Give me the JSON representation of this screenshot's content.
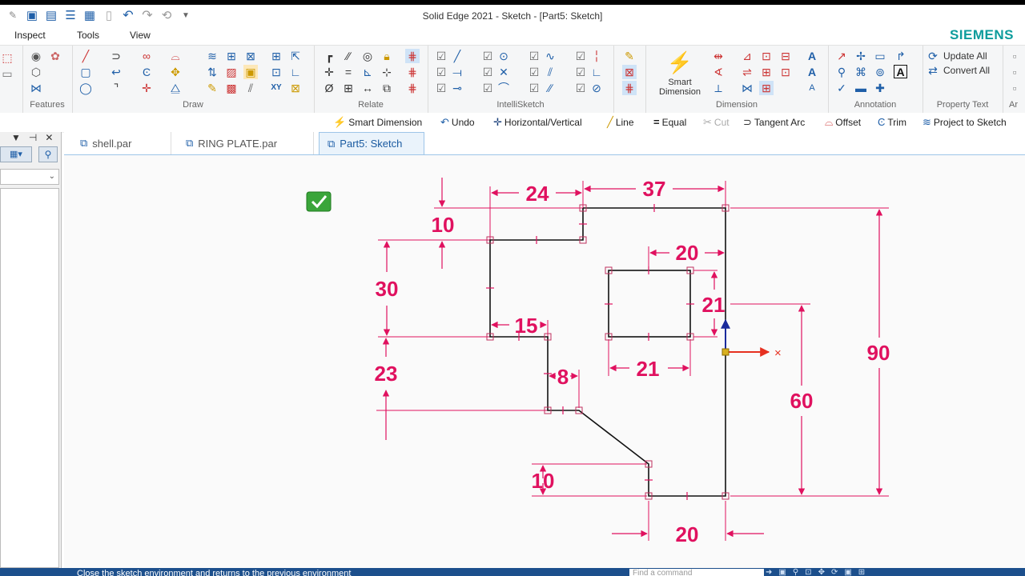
{
  "window": {
    "title": "Solid Edge 2021 - Sketch - [Part5: Sketch]"
  },
  "brand": "SIEMENS",
  "menu": [
    "Inspect",
    "Tools",
    "View"
  ],
  "ribbon": {
    "groups": [
      "Features",
      "Draw",
      "Relate",
      "IntelliSketch",
      "Dimension",
      "Annotation",
      "Property Text",
      "Ar"
    ],
    "smart_dimension": "Smart Dimension",
    "update_all": "Update All",
    "convert_all": "Convert All"
  },
  "command_bar": [
    "Smart Dimension",
    "Undo",
    "Horizontal/Vertical",
    "Line",
    "Equal",
    "Cut",
    "Tangent Arc",
    "Offset",
    "Trim",
    "Project to Sketch"
  ],
  "tabs": [
    "shell.par",
    "RING PLATE.par",
    "Part5: Sketch"
  ],
  "dimensions": {
    "d24": "24",
    "d37": "37",
    "d10_top": "10",
    "d20_inner": "20",
    "d30": "30",
    "d21_vertical": "21",
    "d15": "15",
    "d23": "23",
    "d8": "8",
    "d21_horizontal": "21",
    "d90": "90",
    "d60": "60",
    "d10_bottom": "10",
    "d20_bottom": "20"
  },
  "status": {
    "prompt": "Close the sketch environment and returns to the previous environment",
    "find_placeholder": "Find a command"
  },
  "colors": {
    "dimension": "#e0115f",
    "geometry": "#111111",
    "status_bar": "#1c4f8c",
    "brand": "#0d9c9c"
  }
}
